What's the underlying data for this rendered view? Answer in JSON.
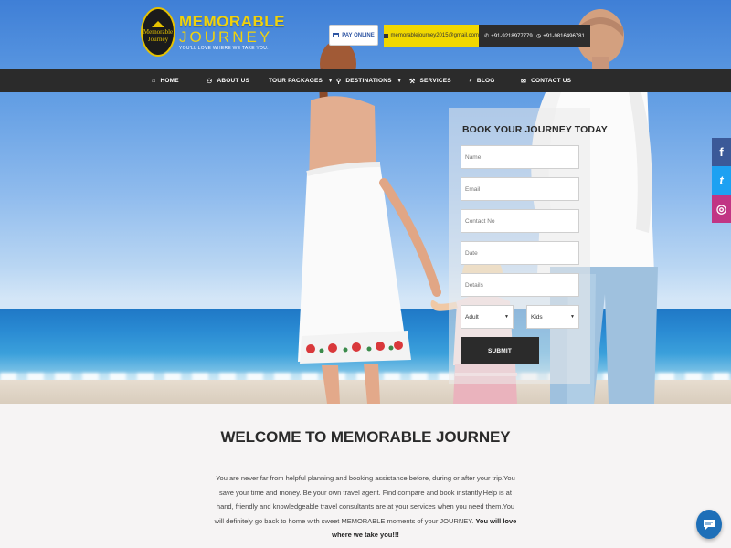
{
  "brand": {
    "logo_badge_line1": "Memorable",
    "logo_badge_line2": "Journey",
    "title_line1": "MEMORABLE",
    "title_line2": "JOURNEY",
    "tagline": "YOU'LL LOVE WHERE WE TAKE YOU."
  },
  "header": {
    "pay_label": "PAY ONLINE",
    "email": "memorablejourney2015@gmail.com",
    "phone1": "+91-9218977779",
    "phone2": "+91-9816496781"
  },
  "nav": {
    "items": [
      {
        "label": "HOME",
        "icon": "home-icon",
        "glyph": "⌂"
      },
      {
        "label": "ABOUT US",
        "icon": "users-icon",
        "glyph": "⚇"
      },
      {
        "label": "TOUR PACKAGES",
        "icon": "",
        "glyph": ""
      },
      {
        "label": "DESTINATIONS",
        "icon": "map-pin-icon",
        "glyph": "⬤"
      },
      {
        "label": "SERVICES",
        "icon": "wrench-icon",
        "glyph": "✎"
      },
      {
        "label": "BLOG",
        "icon": "rss-icon",
        "glyph": "≋"
      },
      {
        "label": "CONTACT US",
        "icon": "envelope-icon",
        "glyph": "✉"
      }
    ]
  },
  "booking": {
    "title": "BOOK YOUR JOURNEY TODAY",
    "name_placeholder": "Name",
    "email_placeholder": "Email",
    "contact_placeholder": "Contact No",
    "date_placeholder": "Date",
    "details_placeholder": "Details",
    "adult_value": "Adult",
    "kids_value": "Kids",
    "submit_label": "SUBMIT"
  },
  "social": {
    "facebook": "f",
    "twitter": "t",
    "instagram": "◎"
  },
  "welcome": {
    "title": "WELCOME TO MEMORABLE JOURNEY",
    "body": "You are never far from helpful planning and booking assistance before, during or after your trip.You save your time and money. Be your own travel agent. Find compare and book instantly.Help is at hand, friendly and knowledgeable travel consultants are at your services when you need them.You will definitely go back to home with sweet MEMORABLE moments of your JOURNEY. ",
    "body_bold": "You will love where we take you!!!"
  },
  "colors": {
    "accent_yellow": "#f1d800",
    "nav_bg": "#2b2b2b",
    "facebook": "#3b5998",
    "twitter": "#1da1f2",
    "instagram": "#c13584",
    "chat": "#1e6fb8"
  }
}
